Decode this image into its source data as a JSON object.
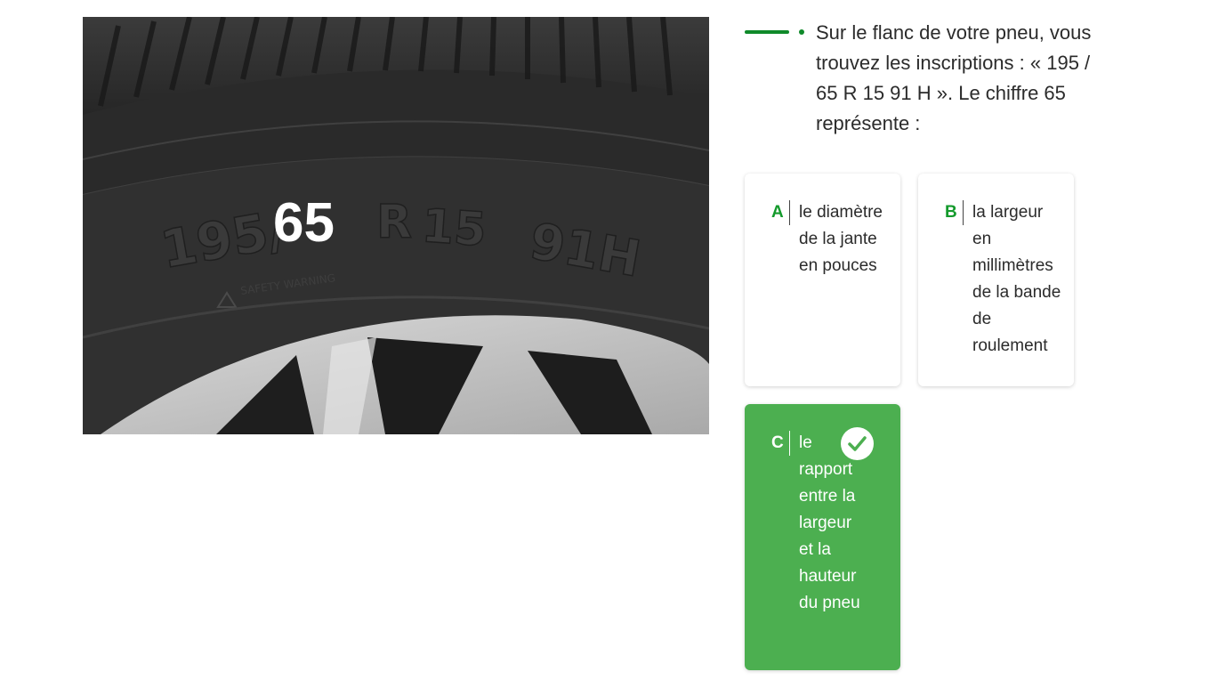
{
  "image": {
    "sidewall": {
      "width_code": "195/",
      "aspect_ratio": "65",
      "construction": "R",
      "rim": "15",
      "load_speed": "91H",
      "warning": "SAFETY WARNING"
    }
  },
  "question": {
    "text": "Sur le flanc de votre pneu, vous trouvez les inscriptions : « 195 / 65 R 15 91 H ». Le chiffre 65 représente :"
  },
  "answers": [
    {
      "letter": "A",
      "text": "le diamètre de la jante en pouces",
      "selected": false
    },
    {
      "letter": "B",
      "text": "la largeur en millimètres de la bande de roulement",
      "selected": false
    },
    {
      "letter": "C",
      "text": "le rapport entre la largeur et la hauteur du pneu",
      "selected": true
    }
  ],
  "colors": {
    "accent": "#0f8a2a",
    "selected_bg": "#4caf50",
    "text": "#2b2b2b"
  },
  "icons": {
    "selected": "check-icon",
    "warning": "warning-triangle-icon"
  }
}
